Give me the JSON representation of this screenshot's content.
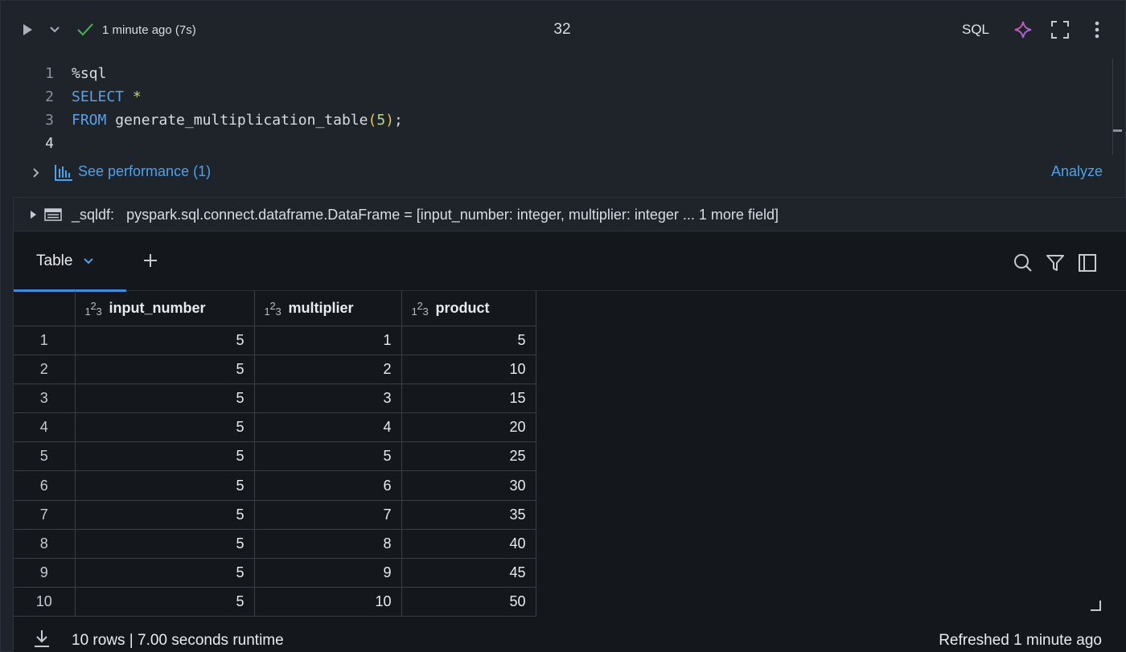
{
  "toolbar": {
    "run_icon": "play-icon",
    "status_icon": "check-icon",
    "status_text": "1 minute ago (7s)",
    "cell_number": "32",
    "language": "SQL",
    "colors": {
      "success": "#3fb950",
      "assistant": "#b86bf5"
    }
  },
  "editor": {
    "lines": [
      {
        "num": "1",
        "parts": [
          {
            "t": "%sql",
            "c": ""
          }
        ]
      },
      {
        "num": "2",
        "parts": [
          {
            "t": "SELECT",
            "c": "kw"
          },
          {
            "t": " ",
            "c": ""
          },
          {
            "t": "*",
            "c": "num"
          }
        ]
      },
      {
        "num": "3",
        "parts": [
          {
            "t": "FROM",
            "c": "kw"
          },
          {
            "t": " generate_multiplication_table",
            "c": ""
          },
          {
            "t": "(",
            "c": "paren"
          },
          {
            "t": "5",
            "c": "num"
          },
          {
            "t": ")",
            "c": "paren"
          },
          {
            "t": ";",
            "c": ""
          }
        ]
      },
      {
        "num": "4",
        "parts": []
      }
    ]
  },
  "performance": {
    "label": "See performance (1)",
    "analyze": "Analyze"
  },
  "result": {
    "df_name": "_sqldf:",
    "df_type": "pyspark.sql.connect.dataframe.DataFrame = [input_number: integer, multiplier: integer ... 1 more field]",
    "tab_label": "Table",
    "columns": [
      {
        "type_glyph": [
          "1",
          "2",
          "3"
        ],
        "name": "input_number"
      },
      {
        "type_glyph": [
          "1",
          "2",
          "3"
        ],
        "name": "multiplier"
      },
      {
        "type_glyph": [
          "1",
          "2",
          "3"
        ],
        "name": "product"
      }
    ],
    "rows": [
      [
        "1",
        "5",
        "1",
        "5"
      ],
      [
        "2",
        "5",
        "2",
        "10"
      ],
      [
        "3",
        "5",
        "3",
        "15"
      ],
      [
        "4",
        "5",
        "4",
        "20"
      ],
      [
        "5",
        "5",
        "5",
        "25"
      ],
      [
        "6",
        "5",
        "6",
        "30"
      ],
      [
        "7",
        "5",
        "7",
        "35"
      ],
      [
        "8",
        "5",
        "8",
        "40"
      ],
      [
        "9",
        "5",
        "9",
        "45"
      ],
      [
        "10",
        "5",
        "10",
        "50"
      ]
    ],
    "footer": {
      "summary": "10 rows  |  7.00 seconds runtime",
      "refreshed": "Refreshed 1 minute ago"
    }
  }
}
